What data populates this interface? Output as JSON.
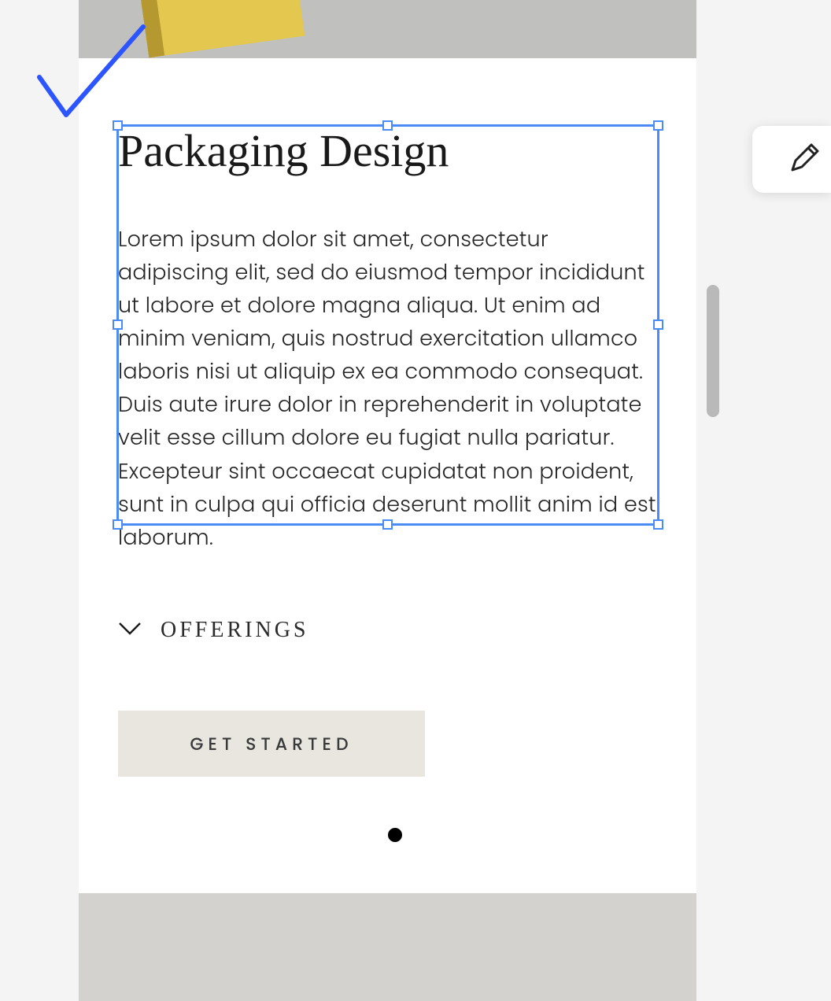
{
  "section": {
    "heading": "Packaging Design",
    "body": "Lorem ipsum dolor sit amet, consectetur adipiscing elit, sed do eiusmod tempor incididunt ut labore et dolore magna aliqua. Ut enim ad minim veniam, quis nostrud exercitation ullamco laboris nisi ut aliquip ex ea commodo consequat. Duis aute irure dolor in reprehenderit in voluptate velit esse cillum dolore eu fugiat nulla pariatur. Excepteur sint occaecat cupidatat non proident, sunt in culpa qui officia deserunt mollit anim id est laborum."
  },
  "accordion": {
    "label": "OFFERINGS"
  },
  "cta": {
    "label": "GET STARTED"
  },
  "editor": {
    "selection_color": "#4a8bf5",
    "checkmark_color": "#2d55ff"
  }
}
